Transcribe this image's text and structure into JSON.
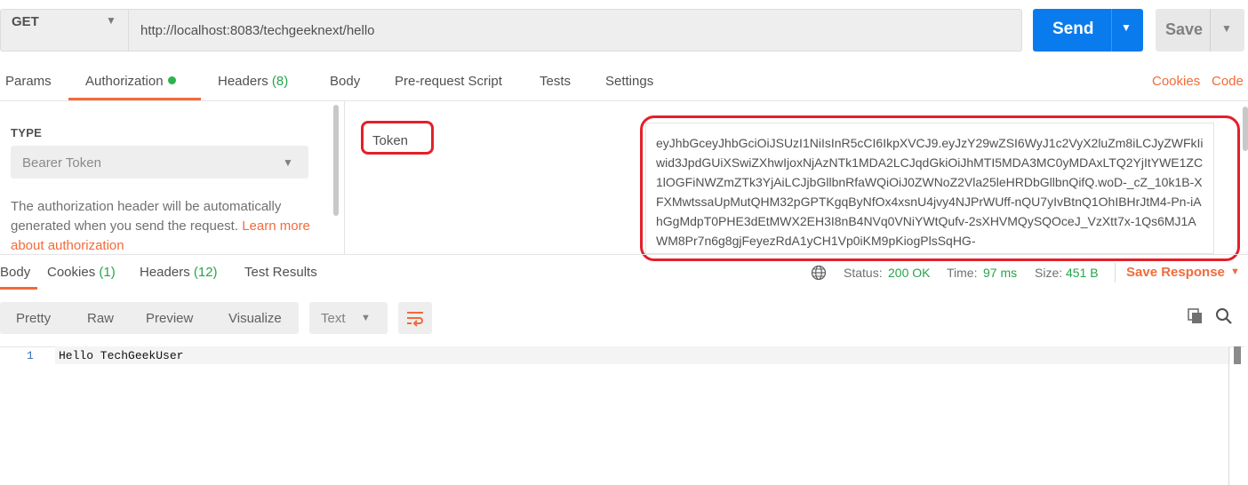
{
  "request": {
    "method": "GET",
    "url": "http://localhost:8083/techgeeknext/hello",
    "send_label": "Send",
    "save_label": "Save"
  },
  "request_tabs": {
    "params": "Params",
    "authorization": "Authorization",
    "headers": "Headers",
    "headers_count": "(8)",
    "body": "Body",
    "pre_request": "Pre-request Script",
    "tests": "Tests",
    "settings": "Settings",
    "cookies_link": "Cookies",
    "code_link": "Code"
  },
  "auth": {
    "type_label": "TYPE",
    "type_value": "Bearer Token",
    "description": "The authorization header will be automatically generated when you send the request. ",
    "learn_more": "Learn more about authorization",
    "token_label": "Token",
    "token_value": "eyJhbGceyJhbGciOiJSUzI1NiIsInR5cCI6IkpXVCJ9.eyJzY29wZSI6WyJ1c2VyX2luZm8iLCJyZWFkIiwid3JpdGUiXSwiZXhwIjoxNjAzNTk1MDA2LCJqdGkiOiJhMTI5MDA3MC0yMDAxLTQ2YjItYWE1ZC1lOGFiNWZmZTk3YjAiLCJjbGllbnRfaWQiOiJ0ZWNoZ2Vla25leHRDbGllbnQifQ.woD-_cZ_10k1B-XFXMwtssaUpMutQHM32pGPTKgqByNfOx4xsnU4jvy4NJPrWUff-nQU7yIvBtnQ1OhIBHrJtM4-Pn-iAhGgMdpT0PHE3dEtMWX2EH3I8nB4NVq0VNiYWtQufv-2sXHVMQySQOceJ_VzXtt7x-1Qs6MJ1AWM8Pr7n6g8gjFeyezRdA1yCH1Vp0iKM9pKiogPlsSqHG-"
  },
  "response_tabs": {
    "body": "Body",
    "cookies": "Cookies",
    "cookies_count": "(1)",
    "headers": "Headers",
    "headers_count": "(12)",
    "test_results": "Test Results"
  },
  "response_meta": {
    "status_label": "Status:",
    "status_value": "200 OK",
    "time_label": "Time:",
    "time_value": "97 ms",
    "size_label": "Size:",
    "size_value": "451 B",
    "save_response": "Save Response"
  },
  "view_options": {
    "pretty": "Pretty",
    "raw": "Raw",
    "preview": "Preview",
    "visualize": "Visualize",
    "format": "Text"
  },
  "response_body": {
    "line_number": "1",
    "line_text": "Hello TechGeekUser"
  },
  "colors": {
    "accent": "#f26b3a",
    "send": "#097bed",
    "success": "#26a54a",
    "annotation": "#e3202a"
  }
}
